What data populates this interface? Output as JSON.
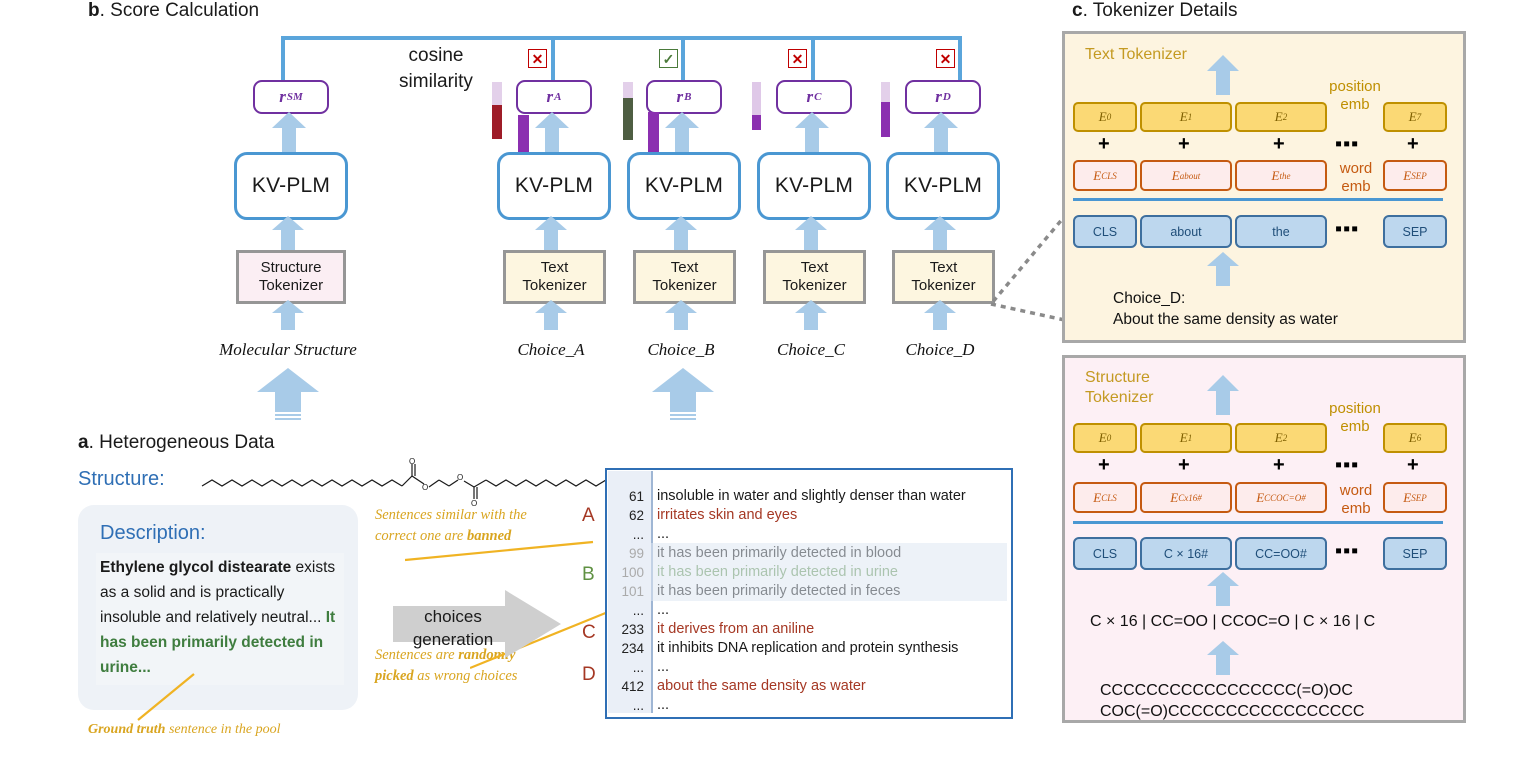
{
  "panels": {
    "b": {
      "letter": "b",
      "title": ". Score Calculation"
    },
    "a": {
      "letter": "a",
      "title": ". Heterogeneous Data"
    },
    "c": {
      "letter": "c",
      "title": ". Tokenizer Details"
    }
  },
  "score_calc": {
    "cosine_label_line1": "cosine",
    "cosine_label_line2": "similarity",
    "model_name": "KV-PLM",
    "r_boxes": [
      {
        "base": "r",
        "sub": "SM"
      },
      {
        "base": "r",
        "sub": "A"
      },
      {
        "base": "r",
        "sub": "B"
      },
      {
        "base": "r",
        "sub": "C"
      },
      {
        "base": "r",
        "sub": "D"
      }
    ],
    "marks": [
      {
        "symbol": "✕",
        "correct": false
      },
      {
        "symbol": "✓",
        "correct": true
      },
      {
        "symbol": "✕",
        "correct": false
      },
      {
        "symbol": "✕",
        "correct": false
      }
    ],
    "tokenizers": [
      {
        "line1": "Structure",
        "line2": "Tokenizer",
        "kind": "struct"
      },
      {
        "line1": "Text",
        "line2": "Tokenizer",
        "kind": "text"
      },
      {
        "line1": "Text",
        "line2": "Tokenizer",
        "kind": "text"
      },
      {
        "line1": "Text",
        "line2": "Tokenizer",
        "kind": "text"
      },
      {
        "line1": "Text",
        "line2": "Tokenizer",
        "kind": "text"
      }
    ],
    "inputs": [
      "Molecular Structure",
      "Choice_A",
      "Choice_B",
      "Choice_C",
      "Choice_D"
    ],
    "colors": {
      "r_border": "#7030a0",
      "kvplm_border": "#4a97d2",
      "arrow": "#a8cbe8",
      "connector": "#5aa5db",
      "wrong": "#c00000",
      "right": "#4a7a3a"
    },
    "vector_bars": [
      {
        "for": "A",
        "top_color": "#e3d0ea",
        "bottom_color": "#9e1c28",
        "purple": "#8b2fb0"
      },
      {
        "for": "B",
        "top_color": "#e3d0ea",
        "bottom_color": "#4e5e42",
        "purple": "#8b2fb0"
      },
      {
        "for": "C",
        "top_color": "#dfc8e8",
        "bottom_color": "#8b2fb0",
        "purple": "#8b2fb0"
      },
      {
        "for": "D",
        "top_color": "#e3d0ea",
        "bottom_color": "#8b2fb0",
        "purple": "#8b2fb0"
      }
    ]
  },
  "heterogeneous": {
    "structure_label": "Structure:",
    "description_label": "Description:",
    "description": {
      "bold_part": "Ethylene glycol distearate",
      "plain_part": " exists as a solid and is practically insoluble and relatively neutral...",
      "green_part": " It has been primarily detected in urine..."
    },
    "ground_truth_note": {
      "bold": "Ground truth",
      "rest": " sentence in the pool"
    },
    "annotation_banned": {
      "line1": "Sentences similar with the",
      "line2_pre": "correct one are ",
      "line2_bold": "banned"
    },
    "annotation_random": {
      "line1_pre": "Sentences are ",
      "line1_bold": "randomly",
      "line2_bold": "picked",
      "line2_post": " as wrong choices"
    },
    "big_arrow": {
      "line1": "choices",
      "line2": "generation"
    },
    "choice_markers": [
      {
        "letter": "A",
        "color": "#a53824"
      },
      {
        "letter": "B",
        "color": "#5f9142"
      },
      {
        "letter": "C",
        "color": "#a53824"
      },
      {
        "letter": "D",
        "color": "#a53824"
      }
    ],
    "pool_rows": [
      {
        "num": "61",
        "text": "insoluble in water and slightly denser than water",
        "style": "plain",
        "numstyle": "plain"
      },
      {
        "num": "62",
        "text": "irritates skin and eyes",
        "style": "red",
        "numstyle": "plain"
      },
      {
        "num": "...",
        "text": "...",
        "style": "plain",
        "numstyle": "plain"
      },
      {
        "num": "99",
        "text": "it has been primarily detected in blood",
        "style": "plain",
        "numstyle": "grey"
      },
      {
        "num": "100",
        "text": "it has been primarily detected in urine",
        "style": "green",
        "numstyle": "grey"
      },
      {
        "num": "101",
        "text": "it has been primarily detected in feces",
        "style": "plain",
        "numstyle": "grey"
      },
      {
        "num": "...",
        "text": "...",
        "style": "plain",
        "numstyle": "plain"
      },
      {
        "num": "233",
        "text": "it derives from an aniline",
        "style": "red",
        "numstyle": "plain"
      },
      {
        "num": "234",
        "text": "it inhibits DNA replication and protein synthesis",
        "style": "plain",
        "numstyle": "plain"
      },
      {
        "num": "...",
        "text": "...",
        "style": "plain",
        "numstyle": "plain"
      },
      {
        "num": "412",
        "text": "about the same density as water",
        "style": "red",
        "numstyle": "plain"
      },
      {
        "num": "...",
        "text": "...",
        "style": "plain",
        "numstyle": "plain"
      }
    ]
  },
  "tokenizer_details": {
    "text_tokenizer": {
      "title": "Text Tokenizer",
      "position_emb_label_l1": "position",
      "position_emb_label_l2": "emb",
      "word_emb_label_l1": "word",
      "word_emb_label_l2": "emb",
      "position_embeddings": [
        "E0",
        "E1",
        "E2",
        "E7"
      ],
      "position_sub": [
        "0",
        "1",
        "2",
        "7"
      ],
      "word_embeddings": [
        "CLS",
        "about",
        "the",
        "SEP"
      ],
      "tokens": [
        "CLS",
        "about",
        "the",
        "SEP"
      ],
      "plus": "+",
      "dots": "▪▪▪",
      "caption_line1": "Choice_D:",
      "caption_line2": "About the same density as water"
    },
    "structure_tokenizer": {
      "title_l1": "Structure",
      "title_l2": "Tokenizer",
      "position_emb_label_l1": "position",
      "position_emb_label_l2": "emb",
      "word_emb_label_l1": "word",
      "word_emb_label_l2": "emb",
      "position_sub": [
        "0",
        "1",
        "2",
        "6"
      ],
      "word_embeddings": [
        "CLS",
        "Cx16#",
        "CCOC=O#",
        "SEP"
      ],
      "tokens": [
        "CLS",
        "C × 16#",
        "CC=OO#",
        "SEP"
      ],
      "plus": "+",
      "dots": "▪▪▪",
      "segmented": "C × 16 | CC=OO | CCOC=O | C × 16 |  C",
      "smiles_line1": "CCCCCCCCCCCCCCCCC(=O)OC",
      "smiles_line2": "COC(=O)CCCCCCCCCCCCCCCCC"
    }
  }
}
